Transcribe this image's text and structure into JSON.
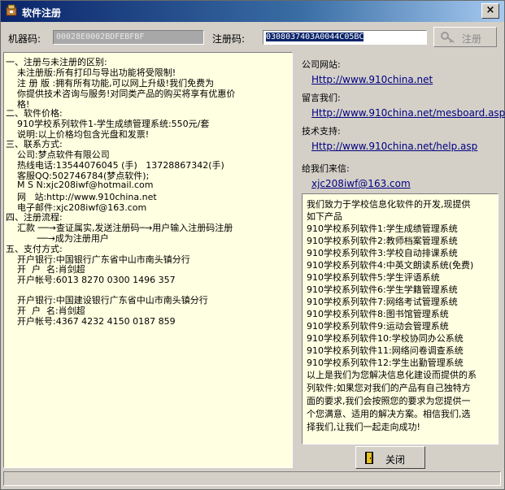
{
  "window": {
    "title": "软件注册",
    "close_label": "×"
  },
  "header": {
    "machine_code_label": "机器码:",
    "machine_code_value": "00028E0002BDFEBFBF",
    "reg_code_label": "注册码:",
    "reg_code_value": "0308037403A0044C05BC",
    "register_label": "注册"
  },
  "info_lines": [
    "一、注册与未注册的区别:",
    "    未注册版:所有打印与导出功能将受限制!",
    "    注 册 版 :拥有所有功能,可以网上升级!我们免费为",
    "    你提供技术咨询与服务!对同类产品的购买将享有优惠价",
    "    格!",
    "二、软件价格:",
    "    910学校系列软件1-学生成绩管理系统:550元/套",
    "    说明:以上价格均包含光盘和发票!",
    "三、联系方式:",
    "    公司:梦点软件有限公司",
    "    热线电话:13544076045 (手)   13728867342(手)",
    "    客服QQ:502746784(梦点软件);",
    "    M S N:xjc208iwf@hotmail.com",
    "    网   站:http://www.910china.net",
    "    电子邮件:xjc208iwf@163.com",
    "四、注册流程:",
    "    汇款 ──→查证属实,发送注册码─→用户输入注册码注册",
    "           ──→成为注册用户",
    "五、支付方式:",
    "    开户银行:中国银行广东省中山市南头镇分行",
    "    开  户  名:肖剑超",
    "    开户帐号:6013 8270 0300 1496 357",
    "",
    "    开户银行:中国建设银行广东省中山市南头镇分行",
    "    开  户  名:肖剑超",
    "    开户帐号:4367 4232 4150 0187 859"
  ],
  "contacts": [
    {
      "label": "公司网站:",
      "link": "Http://www.910china.net"
    },
    {
      "label": "留言我们:",
      "link": "Http://www.910china.net/mesboard.asp"
    },
    {
      "label": "技术支持:",
      "link": "Http://www.910china.net/help.asp"
    },
    {
      "label": "给我们来信:",
      "link": "xjc208iwf@163.com"
    }
  ],
  "description_lines": [
    "我们致力于学校信息化软件的开发,现提供",
    "如下产品",
    "910学校系列软件1:学生成绩管理系统",
    "910学校系列软件2:教师档案管理系统",
    "910学校系列软件3:学校自动排课系统",
    "910学校系列软件4:中英文朗读系统(免费)",
    "910学校系列软件5:学生评语系统",
    "910学校系列软件6:学生学籍管理系统",
    "910学校系列软件7:网络考试管理系统",
    "910学校系列软件8:图书馆管理系统",
    "910学校系列软件9:运动会管理系统",
    "910学校系列软件10:学校协同办公系统",
    "910学校系列软件11:网络问卷调查系统",
    "910学校系列软件12:学生出勤管理系统",
    "以上是我们为您解决信息化建设而提供的系",
    "列软件;如果您对我们的产品有自己独特方",
    "面的要求,我们会按照您的要求为您提供一",
    "个您满意、适用的解决方案。相信我们,选",
    "择我们,让我们一起走向成功!"
  ],
  "close_button_label": "关闭",
  "colors": {
    "title_start": "#0a246a",
    "title_end": "#a6caf0",
    "panel_bg": "#ffffe1",
    "link": "#000080"
  },
  "icons": [
    "app-icon",
    "key-icon",
    "exit-door-icon"
  ]
}
